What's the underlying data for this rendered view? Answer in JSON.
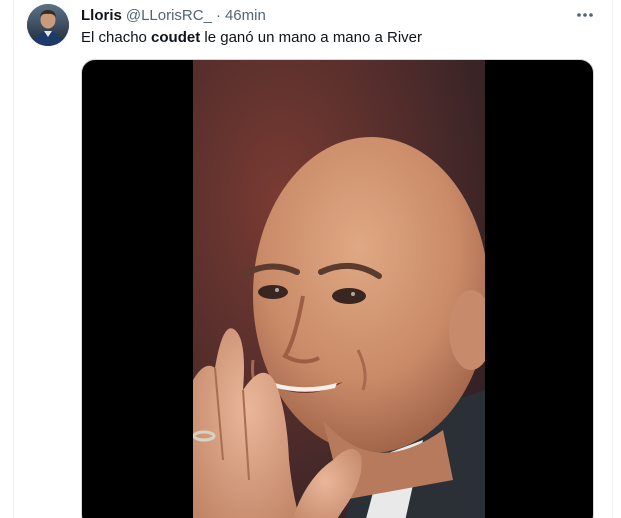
{
  "tweet": {
    "author": {
      "display_name": "Lloris",
      "handle": "@LLorisRC_",
      "separator": "·",
      "timestamp": "46min",
      "avatar_icon": "user-avatar"
    },
    "text": {
      "part1": "El chacho ",
      "bold": "coudet",
      "part2": " le ganó un mano a mano a River"
    },
    "more_icon": "more-horizontal-icon",
    "media": {
      "kind": "video",
      "subject": "man-smiling-hands-clasped"
    }
  },
  "colors": {
    "text_primary": "#0f1419",
    "text_secondary": "#536471",
    "media_background": "#000000",
    "border": "#cfd9de"
  }
}
